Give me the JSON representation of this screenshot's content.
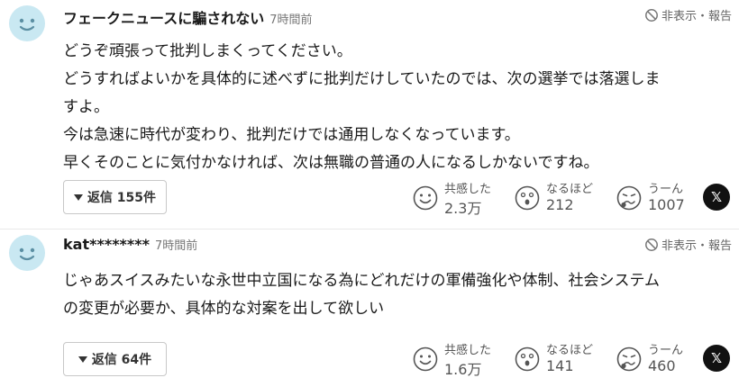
{
  "report_label": "非表示・報告",
  "comments": [
    {
      "username": "フェークニュースに騙されない",
      "time": "7時間前",
      "body": [
        "どうぞ頑張って批判しまくってください。",
        "どうすればよいかを具体的に述べずに批判だけしていたのでは、次の選挙では落選しま",
        "すよ。",
        "今は急速に時代が変わり、批判だけでは通用しなくなっています。",
        "早くそのことに気付かなければ、次は無職の普通の人になるしかないですね。"
      ],
      "reply_label": "返信 155件",
      "reactions": [
        {
          "label": "共感した",
          "count": "2.3万",
          "icon": "smile-icon"
        },
        {
          "label": "なるほど",
          "count": "212",
          "icon": "surprised-icon"
        },
        {
          "label": "うーん",
          "count": "1007",
          "icon": "confused-icon"
        }
      ],
      "share_icon": "x-share-icon",
      "share_glyph": "𝕏"
    },
    {
      "username": "kat********",
      "time": "7時間前",
      "body": [
        "じゃあスイスみたいな永世中立国になる為にどれだけの軍備強化や体制、社会システム",
        "の変更が必要か、具体的な対案を出して欲しい"
      ],
      "reply_label": "返信 64件",
      "reactions": [
        {
          "label": "共感した",
          "count": "1.6万",
          "icon": "smile-icon"
        },
        {
          "label": "なるほど",
          "count": "141",
          "icon": "surprised-icon"
        },
        {
          "label": "うーん",
          "count": "460",
          "icon": "confused-icon"
        }
      ],
      "share_icon": "x-share-icon",
      "share_glyph": "𝕏"
    }
  ],
  "colors": {
    "avatar_bg": "#c9e8f2",
    "text": "#1a1a1a",
    "muted": "#777777"
  }
}
